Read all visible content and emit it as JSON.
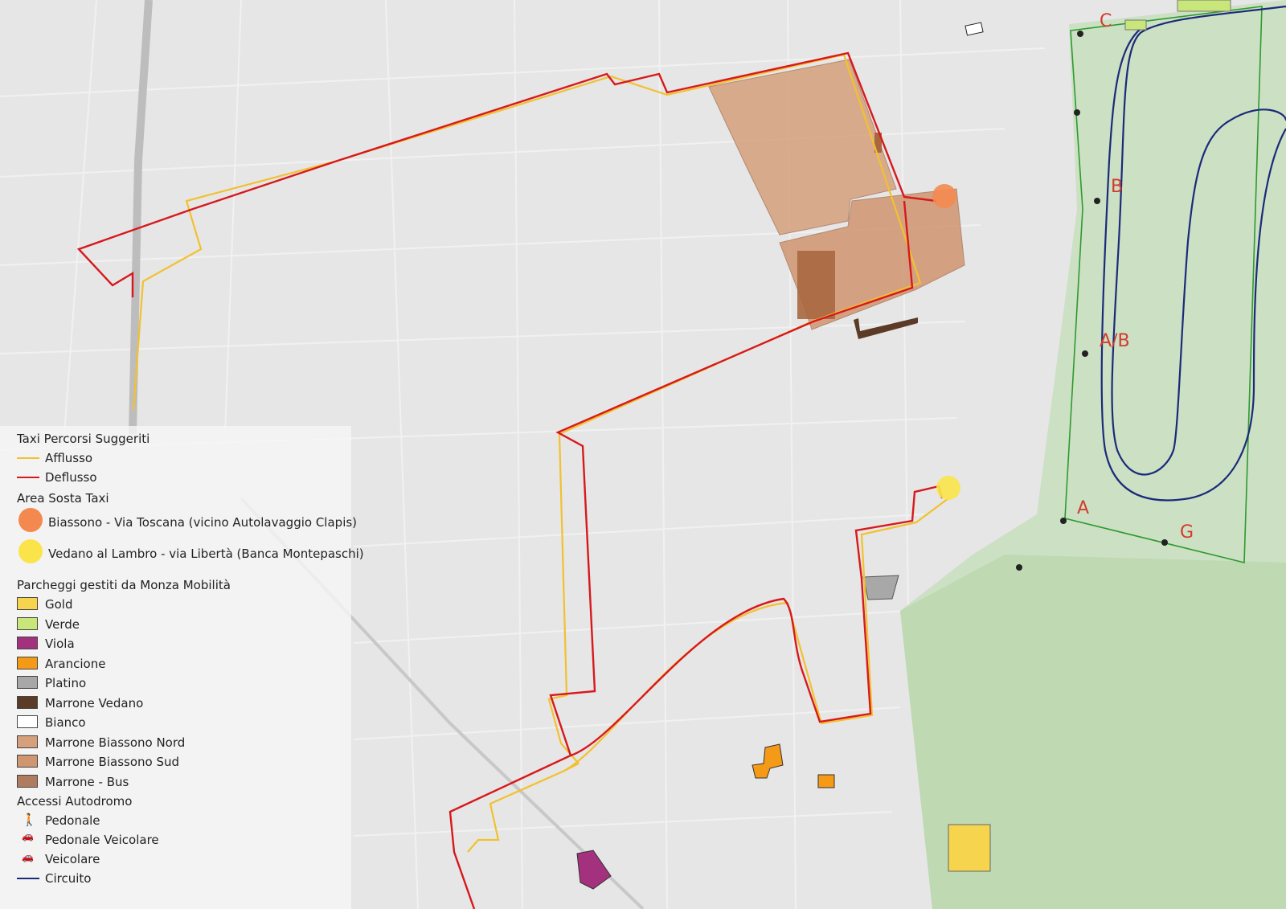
{
  "legend": {
    "taxi_routes_title": "Taxi Percorsi Suggeriti",
    "route_inflow": "Afflusso",
    "route_outflow": "Deflusso",
    "taxi_area_title": "Area Sosta Taxi",
    "taxi_area_biassono": "Biassono - Via Toscana (vicino Autolavaggio Clapis)",
    "taxi_area_vedano": "Vedano al Lambro - via Libertà (Banca Montepaschi)",
    "parking_title": "Parcheggi gestiti da Monza Mobilità",
    "parking_items": [
      {
        "label": "Gold",
        "color": "#f6d44d"
      },
      {
        "label": "Verde",
        "color": "#c9e67a"
      },
      {
        "label": "Viola",
        "color": "#a3317e"
      },
      {
        "label": "Arancione",
        "color": "#f59a16"
      },
      {
        "label": "Platino",
        "color": "#a8a8a8"
      },
      {
        "label": "Marrone Vedano",
        "color": "#5b3b26"
      },
      {
        "label": "Bianco",
        "color": "#ffffff"
      },
      {
        "label": "Marrone Biassono Nord",
        "color": "#d6a07d"
      },
      {
        "label": "Marrone Biassono Sud",
        "color": "#d09670"
      },
      {
        "label": "Marrone - Bus",
        "color": "#b07c60"
      }
    ],
    "access_title": "Accessi Autodromo",
    "access_pedestrian": "Pedonale",
    "access_ped_vehicle": "Pedonale Veicolare",
    "access_vehicle": "Veicolare",
    "circuit": "Circuito"
  },
  "colors": {
    "afflusso": "#f2c12e",
    "deflusso": "#d7191c",
    "circuit": "#1b2a7a",
    "park_boundary": "#2e9a2e",
    "taxi_biassono": "#f4894f",
    "taxi_vedano": "#fbe44a"
  },
  "access_points": [
    "C",
    "B",
    "A/B",
    "A",
    "G"
  ]
}
